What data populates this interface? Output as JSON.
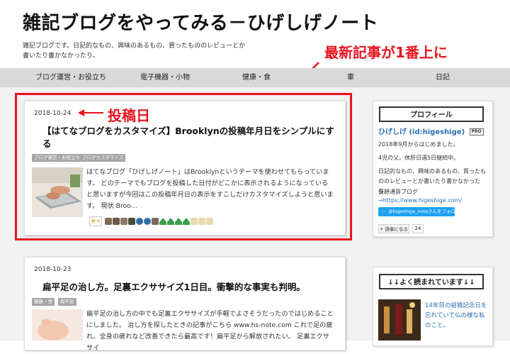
{
  "site": {
    "title": "雑記ブログをやってみる－ひげしげノート",
    "description": "雑記ブログです。日記的なもの、興味のあるもの、買ったもののレビューとか書いたり書かなかったり。"
  },
  "annotations": {
    "top_label": "最新記事が1番上に",
    "date_label": "投稿日",
    "color": "#e8141e"
  },
  "nav": {
    "items": [
      {
        "label": "ブログ運営・お役立ち"
      },
      {
        "label": "電子機器・小物"
      },
      {
        "label": "健康・食"
      },
      {
        "label": "車"
      },
      {
        "label": "日記"
      }
    ]
  },
  "posts": [
    {
      "date": "2018-10-24",
      "title": "【はてなブログをカスタマイズ】Brooklynの投稿年月日をシンプルにする",
      "tags": [
        "ブログ運営・お役立ち",
        "ブログカスタマイズ"
      ],
      "excerpt": "はてなブログ「ひげしげノート」はBrooklynというテーマを使わせてもらっています。 どのテーマでもブログを投稿した日付がどこかに表示されるようになっていると思いますが今回はこの投稿年月日の表示をすこしだけカスタマイズしようと思います。 現状 Broo…",
      "stars": [
        "star-add-icon",
        "avatar-icon",
        "avatar-icon",
        "avatar-icon",
        "avatar-icon",
        "avatar-icon",
        "avatar-icon",
        "avatar-icon",
        "avatar-icon",
        "avatar-icon",
        "avatar-icon",
        "avatar-icon",
        "avatar-icon",
        "avatar-icon",
        "avatar-icon"
      ]
    },
    {
      "date": "2018-10-23",
      "title": "扁平足の治し方。足裏エクササイズ1日目。衝撃的な事実も判明。",
      "tags": [
        "健康・食",
        "扁平足"
      ],
      "excerpt": "扁平足の治し方の中でも足裏エクササイズが手軽でよさそうだったのではじめることにしました。 治し方を探したときの記事がこちら www.hs-note.com これで足の疲れ、全身の疲れなど改善できたら最高です！扁平足から解放されたい。 足裏エクササイ"
    }
  ],
  "profile": {
    "heading": "プロフィール",
    "name": "ひげしげ",
    "id": "(id:higeshige)",
    "badge": "PRO",
    "started": "2018年9月からはじめました。",
    "kids": "4児の父。休肝日週5日継続中。",
    "bio": "日記的なもの、興味のあるもの、買ったもののレビューとか書いたり書かなかったり。",
    "crypto_label": "仮想通貨ブログ",
    "crypto_link": "→https://www.higeshige.com/",
    "follow_label": "@higeshige_noteさんをフォロー",
    "reader_label": "読者になる",
    "reader_count": "24"
  },
  "popular": {
    "heading": "↓↓よく読まれています↓↓",
    "item": "14年目の結婚記念日を忘れていて仏の様な私のこと。"
  }
}
